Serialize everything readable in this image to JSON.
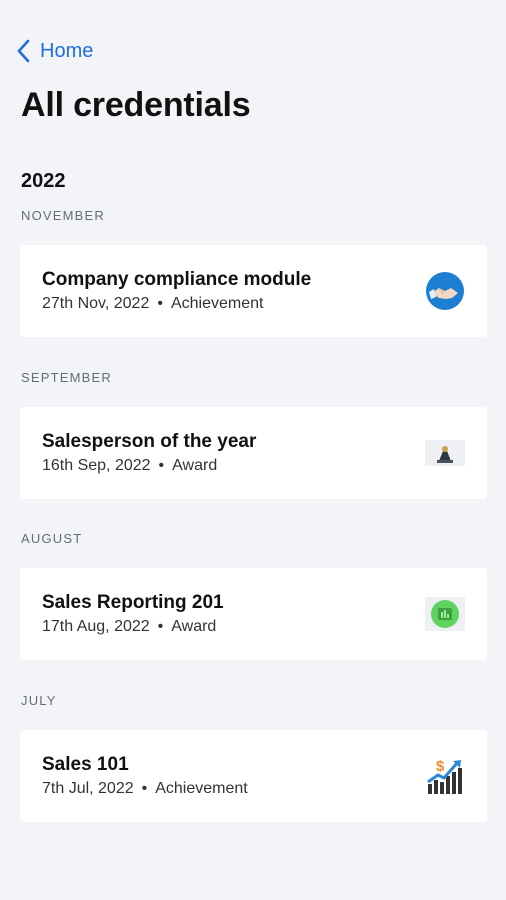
{
  "nav": {
    "back_label": "Home"
  },
  "page": {
    "title": "All credentials"
  },
  "year": "2022",
  "groups": [
    {
      "month": "NOVEMBER",
      "title": "Company compliance module",
      "date": "27th Nov, 2022",
      "type": "Achievement",
      "icon": "handshake-icon"
    },
    {
      "month": "SEPTEMBER",
      "title": "Salesperson of the year",
      "date": "16th Sep, 2022",
      "type": "Award",
      "icon": "award-icon"
    },
    {
      "month": "AUGUST",
      "title": "Sales Reporting 201",
      "date": "17th Aug, 2022",
      "type": "Award",
      "icon": "report-badge-icon"
    },
    {
      "month": "JULY",
      "title": "Sales 101",
      "date": "7th Jul, 2022",
      "type": "Achievement",
      "icon": "sales-growth-icon"
    }
  ],
  "colors": {
    "accent": "#1f6fe0",
    "background": "#f2f4f7"
  }
}
